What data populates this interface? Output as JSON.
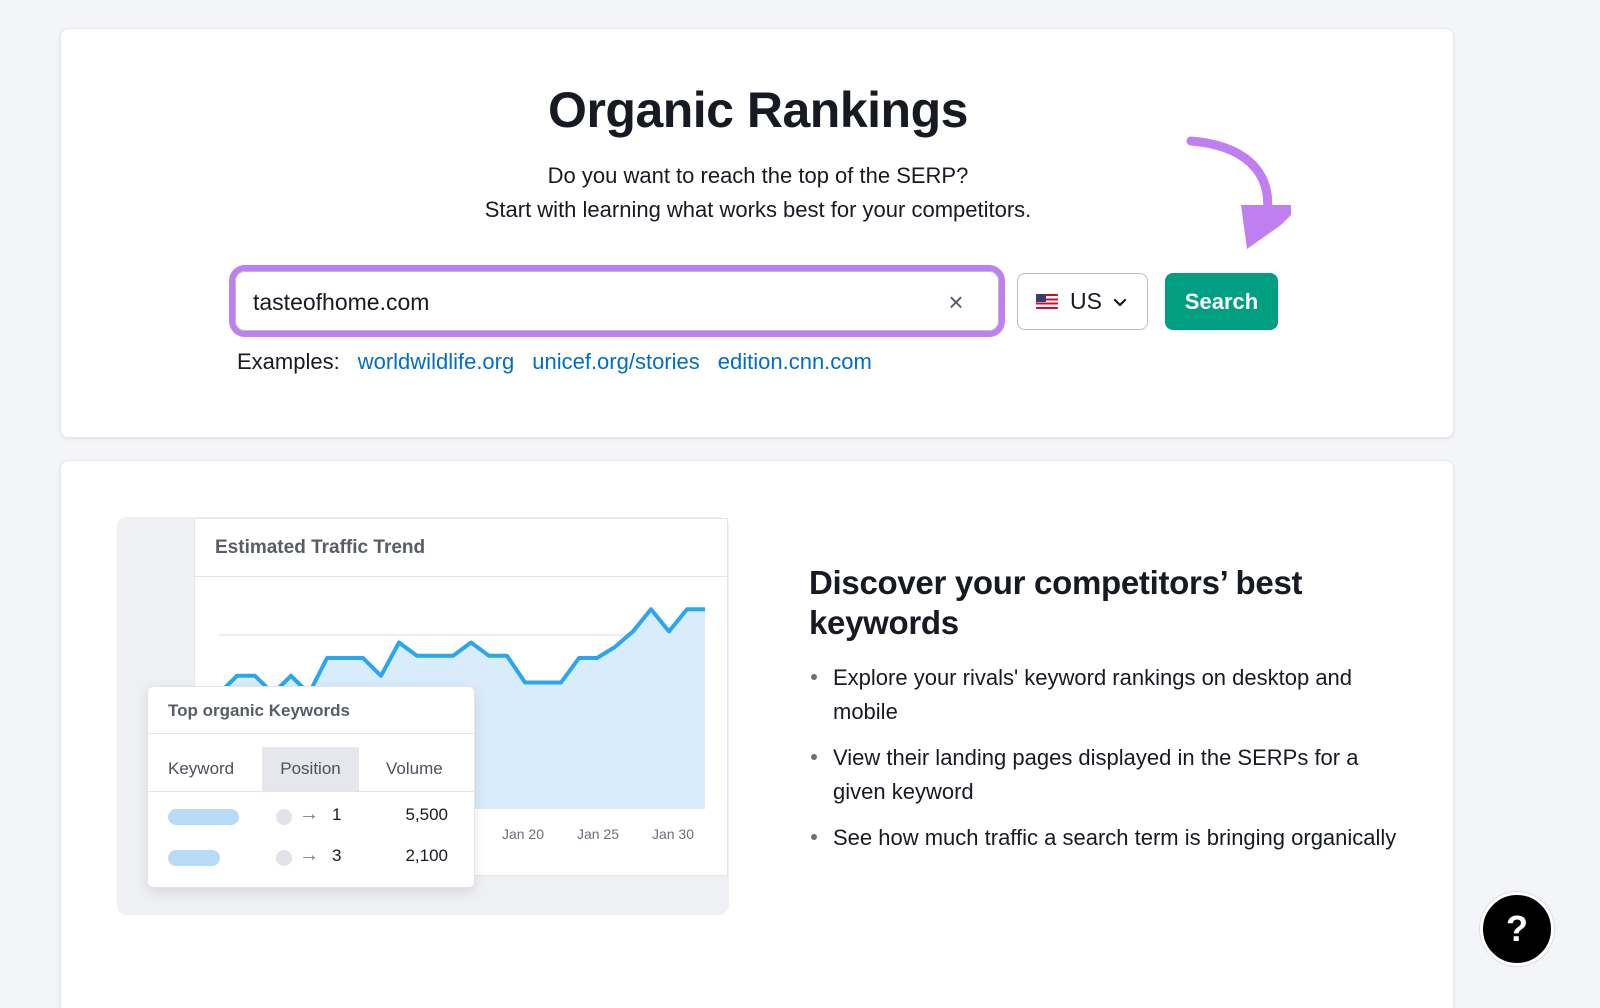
{
  "header": {
    "title": "Organic Rankings",
    "subtitle_line1": "Do you want to reach the top of the SERP?",
    "subtitle_line2": "Start with learning what works best for your competitors."
  },
  "search": {
    "value": "tasteofhome.com",
    "clear_icon": "×",
    "country": "US",
    "country_flag": "us-flag-icon",
    "button_label": "Search",
    "accent_color": "#c07ff0",
    "button_color": "#009f81"
  },
  "examples": {
    "label": "Examples:",
    "links": [
      "worldwildlife.org",
      "unicef.org/stories",
      "edition.cnn.com"
    ]
  },
  "illustration": {
    "trend_title": "Estimated Traffic Trend",
    "keywords_title": "Top organic Keywords",
    "columns": [
      "Keyword",
      "Position",
      "Volume"
    ],
    "rows": [
      {
        "position": "1",
        "volume": "5,500"
      },
      {
        "position": "3",
        "volume": "2,100"
      }
    ],
    "arrow_glyph": "→"
  },
  "chart_data": {
    "type": "area",
    "title": "Estimated Traffic Trend",
    "x_tick_labels": [
      "Jan 20",
      "Jan 25",
      "Jan 30"
    ],
    "values": [
      52,
      60,
      60,
      52,
      60,
      52,
      68,
      68,
      68,
      60,
      75,
      69,
      69,
      69,
      75,
      69,
      69,
      57,
      57,
      57,
      68,
      68,
      73,
      80,
      90,
      80,
      90,
      90
    ],
    "ylim": [
      0,
      100
    ],
    "series_color": "#2aa6f0",
    "fill_color": "#d9ecfb",
    "grid": true
  },
  "feature": {
    "title": "Discover your competitors’ best keywords",
    "bullets": [
      "Explore your rivals' keyword rankings on desktop and mobile",
      "View their landing pages displayed in the SERPs for a given keyword",
      "See how much traffic a search term is bringing organically"
    ]
  },
  "help": {
    "label": "?"
  }
}
